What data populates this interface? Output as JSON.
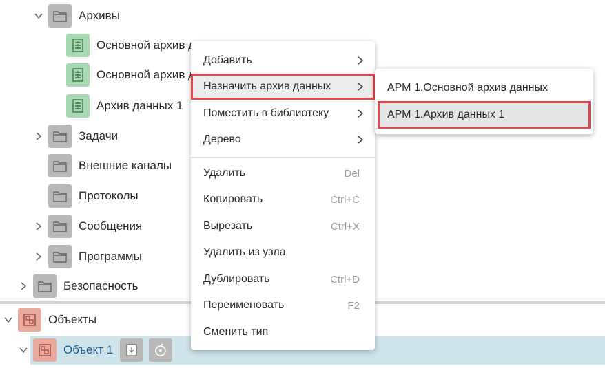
{
  "tree": {
    "archives": "Архивы",
    "archive_items": [
      "Основной архив данных",
      "Основной архив данных",
      "Архив данных 1"
    ],
    "tasks": "Задачи",
    "external_channels": "Внешние каналы",
    "protocols": "Протоколы",
    "messages": "Сообщения",
    "programs": "Программы",
    "security": "Безопасность",
    "objects": "Объекты",
    "object1": "Объект 1"
  },
  "context_menu": {
    "items": [
      {
        "label": "Добавить",
        "shortcut": "",
        "submenu": true
      },
      {
        "label": "Назначить архив данных",
        "shortcut": "",
        "submenu": true,
        "highlighted": true
      },
      {
        "label": "Поместить в библиотеку",
        "shortcut": "",
        "submenu": true
      },
      {
        "label": "Дерево",
        "shortcut": "",
        "submenu": true
      },
      {
        "label": "Удалить",
        "shortcut": "Del"
      },
      {
        "label": "Копировать",
        "shortcut": "Ctrl+C"
      },
      {
        "label": "Вырезать",
        "shortcut": "Ctrl+X"
      },
      {
        "label": "Удалить из узла",
        "shortcut": ""
      },
      {
        "label": "Дублировать",
        "shortcut": "Ctrl+D"
      },
      {
        "label": "Переименовать",
        "shortcut": "F2"
      },
      {
        "label": "Сменить тип",
        "shortcut": ""
      }
    ]
  },
  "submenu": {
    "items": [
      "АРМ 1.Основной архив данных",
      "АРМ 1.Архив данных 1"
    ],
    "highlighted_index": 1
  },
  "colors": {
    "folder_icon_bg": "#b9b9b9",
    "archive_icon_bg": "#a9d9b2",
    "object_icon_bg": "#e9aaa0",
    "selection_bg": "#cfe3ea",
    "highlight_border": "#e2474d",
    "selected_text": "#1d5b8a"
  }
}
